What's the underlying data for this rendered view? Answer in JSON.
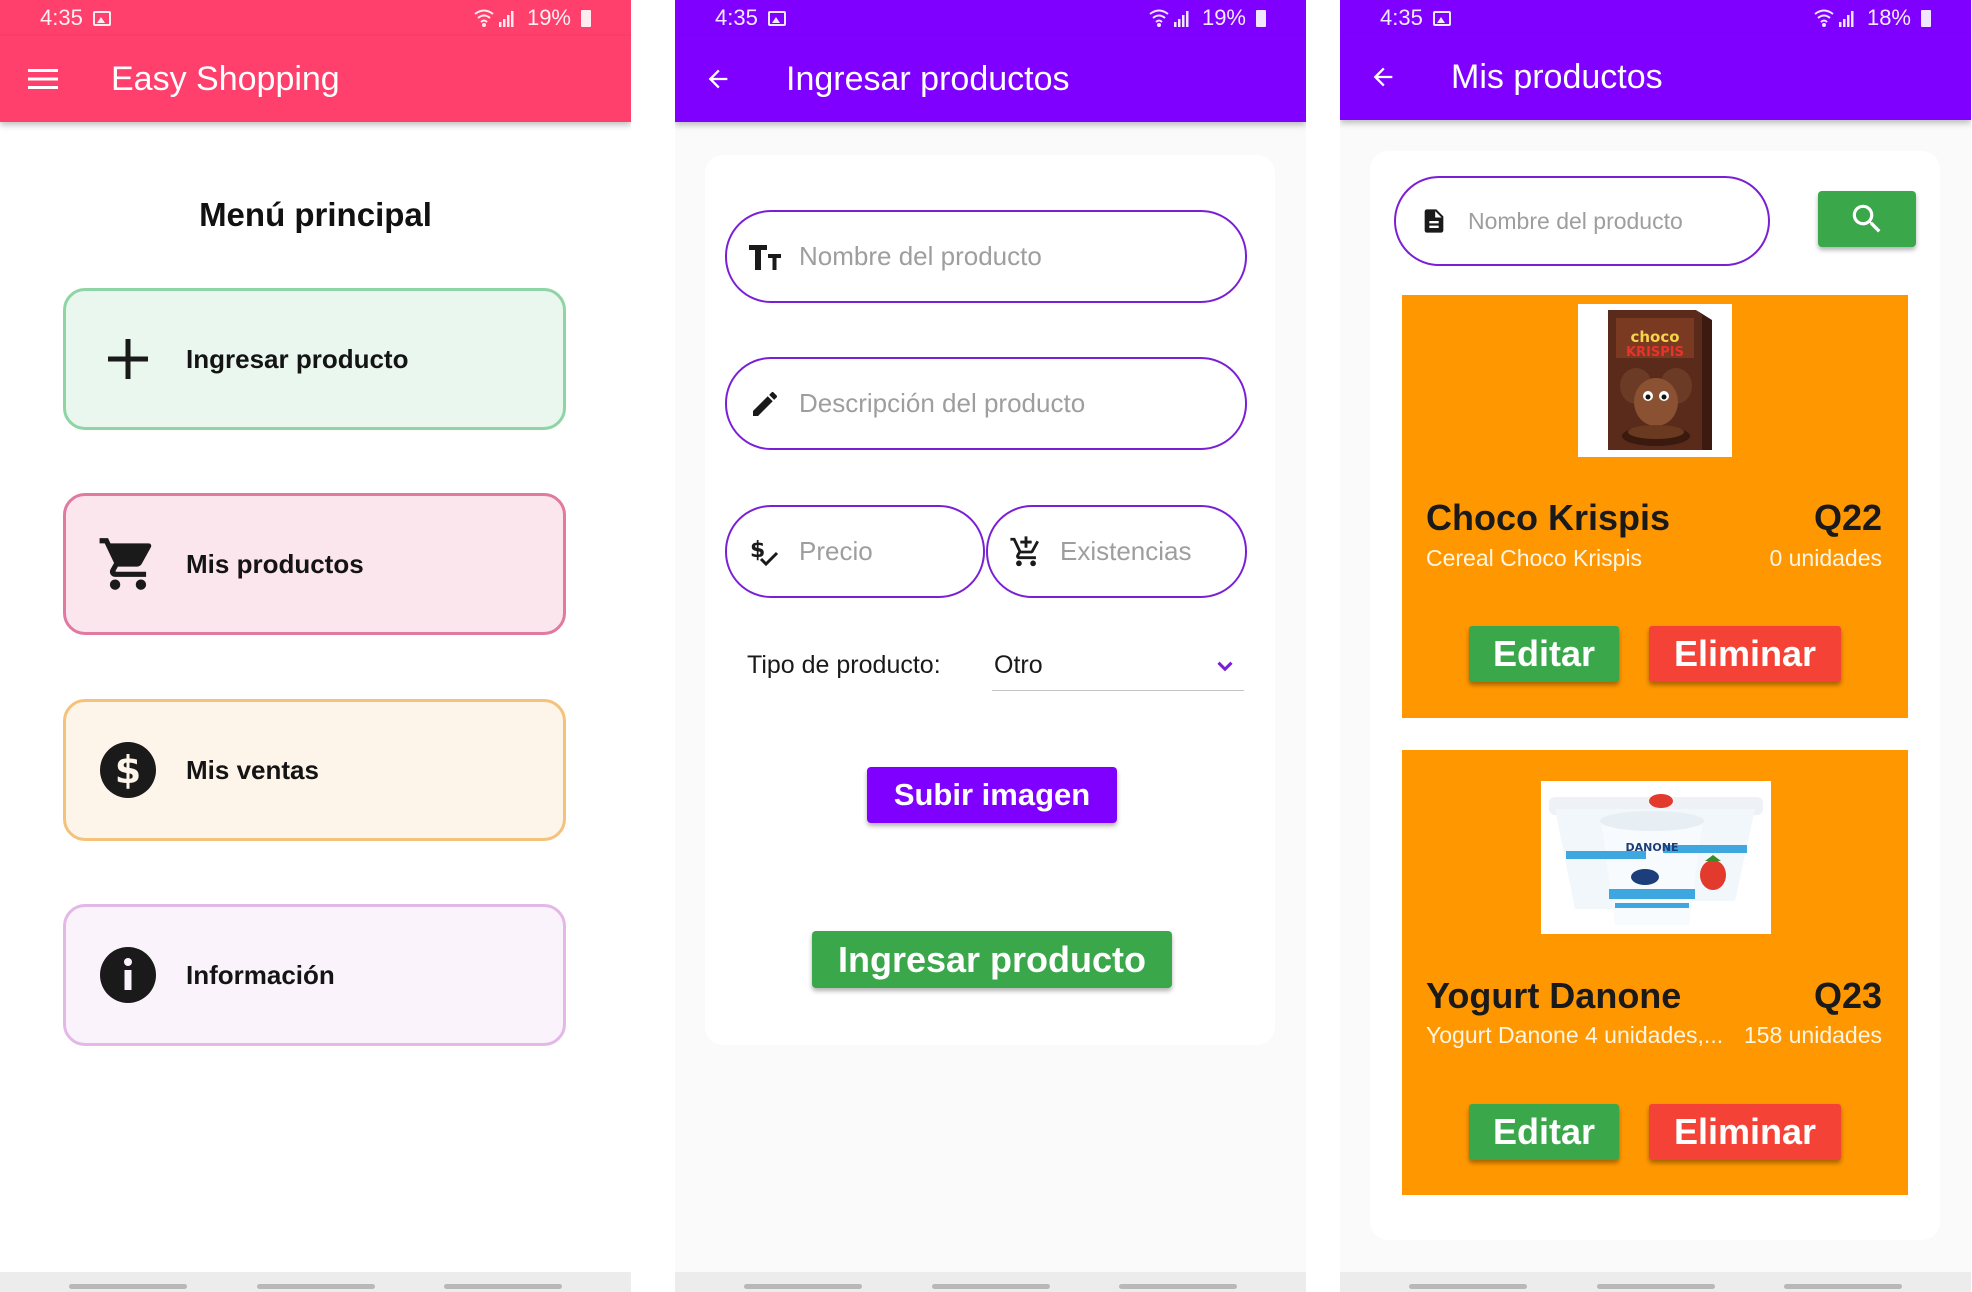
{
  "status_bars": [
    {
      "time": "4:35",
      "battery": "19%"
    },
    {
      "time": "4:35",
      "battery": "19%"
    },
    {
      "time": "4:35",
      "battery": "18%"
    }
  ],
  "screen1": {
    "app_title": "Easy Shopping",
    "menu_title": "Menú principal",
    "items": [
      {
        "label": "Ingresar producto",
        "icon": "plus-icon"
      },
      {
        "label": "Mis productos",
        "icon": "cart-icon"
      },
      {
        "label": "Mis ventas",
        "icon": "dollar-icon"
      },
      {
        "label": "Información",
        "icon": "info-icon"
      }
    ]
  },
  "screen2": {
    "title": "Ingresar productos",
    "name_placeholder": "Nombre del producto",
    "description_placeholder": "Descripción del producto",
    "price_placeholder": "Precio",
    "stock_placeholder": "Existencias",
    "type_label": "Tipo de producto:",
    "type_value": "Otro",
    "upload_button": "Subir imagen",
    "submit_button": "Ingresar producto"
  },
  "screen3": {
    "title": "Mis productos",
    "search_placeholder": "Nombre del producto",
    "products": [
      {
        "name": "Choco Krispis",
        "price": "Q22",
        "description": "Cereal Choco Krispis",
        "stock": "0 unidades",
        "edit": "Editar",
        "delete": "Eliminar"
      },
      {
        "name": "Yogurt Danone",
        "price": "Q23",
        "description": "Yogurt Danone 4 unidades,...",
        "stock": "158 unidades",
        "edit": "Editar",
        "delete": "Eliminar"
      }
    ]
  },
  "colors": {
    "pink_appbar": "#ff3f6c",
    "purple_appbar": "#8000ff",
    "green_button": "#3aa84a",
    "red_button": "#f44336",
    "orange_card": "#ff9800"
  }
}
